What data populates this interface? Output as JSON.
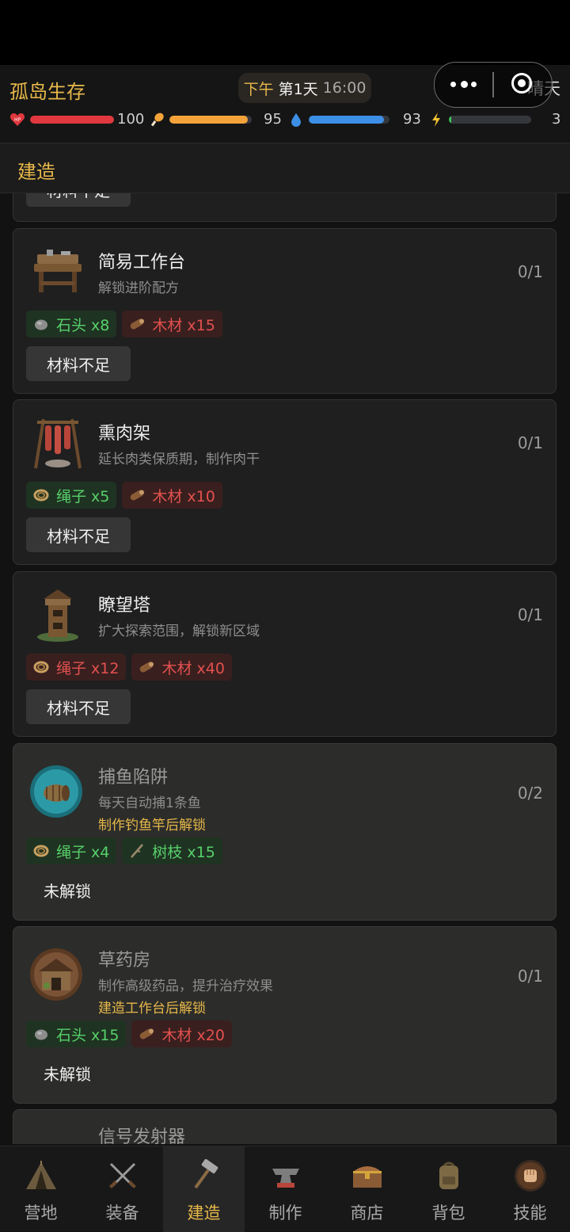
{
  "header": {
    "app_title": "孤岛生存",
    "period": "下午",
    "day": "第1天",
    "clock": "16:00",
    "weather": "晴天"
  },
  "stats": [
    {
      "name": "health",
      "icon": "heart-hp-icon",
      "value": "100",
      "fill": 1.0,
      "color": "#e0383e"
    },
    {
      "name": "hunger",
      "icon": "drumstick-icon",
      "value": "95",
      "fill": 0.95,
      "color": "#f3a33a"
    },
    {
      "name": "thirst",
      "icon": "water-drop-icon",
      "value": "93",
      "fill": 0.93,
      "color": "#3d8fe6"
    },
    {
      "name": "energy",
      "icon": "lightning-icon",
      "value": "3",
      "fill": 0.03,
      "color": "#3fc45a"
    }
  ],
  "section": {
    "title": "建造"
  },
  "partial_top_card": {
    "button": "材料不足"
  },
  "cards": [
    {
      "name": "简易工作台",
      "desc": "解锁进阶配方",
      "count": "0/1",
      "locked": false,
      "button": "材料不足",
      "materials": [
        {
          "icon": "stone-icon",
          "label": "石头 x8",
          "enough": true
        },
        {
          "icon": "wood-icon",
          "label": "木材 x15",
          "enough": false
        }
      ]
    },
    {
      "name": "熏肉架",
      "desc": "延长肉类保质期，制作肉干",
      "count": "0/1",
      "locked": false,
      "button": "材料不足",
      "materials": [
        {
          "icon": "rope-icon",
          "label": "绳子 x5",
          "enough": true
        },
        {
          "icon": "wood-icon",
          "label": "木材 x10",
          "enough": false
        }
      ]
    },
    {
      "name": "瞭望塔",
      "desc": "扩大探索范围，解锁新区域",
      "count": "0/1",
      "locked": false,
      "button": "材料不足",
      "materials": [
        {
          "icon": "rope-icon",
          "label": "绳子 x12",
          "enough": false
        },
        {
          "icon": "wood-icon",
          "label": "木材 x40",
          "enough": false
        }
      ]
    },
    {
      "name": "捕鱼陷阱",
      "desc": "每天自动捕1条鱼",
      "requirement": "制作钓鱼竿后解锁",
      "count": "0/2",
      "locked": true,
      "button": "未解锁",
      "materials": [
        {
          "icon": "rope-icon",
          "label": "绳子 x4",
          "enough": true
        },
        {
          "icon": "branch-icon",
          "label": "树枝 x15",
          "enough": true
        }
      ]
    },
    {
      "name": "草药房",
      "desc": "制作高级药品，提升治疗效果",
      "requirement": "建造工作台后解锁",
      "count": "0/1",
      "locked": true,
      "button": "未解锁",
      "materials": [
        {
          "icon": "stone-icon",
          "label": "石头 x15",
          "enough": true
        },
        {
          "icon": "wood-icon",
          "label": "木材 x20",
          "enough": false
        }
      ]
    },
    {
      "name": "信号发射器",
      "locked": true
    }
  ],
  "tabs": [
    {
      "label": "营地",
      "icon": "tent-icon",
      "active": false
    },
    {
      "label": "装备",
      "icon": "crossed-swords-icon",
      "active": false
    },
    {
      "label": "建造",
      "icon": "hammer-icon",
      "active": true
    },
    {
      "label": "制作",
      "icon": "anvil-icon",
      "active": false
    },
    {
      "label": "商店",
      "icon": "treasure-chest-icon",
      "active": false
    },
    {
      "label": "背包",
      "icon": "backpack-icon",
      "active": false
    },
    {
      "label": "技能",
      "icon": "fist-icon",
      "active": false
    }
  ],
  "colors": {
    "accent": "#e7b84a",
    "ok": "#57d06a",
    "missing": "#e2514e"
  }
}
